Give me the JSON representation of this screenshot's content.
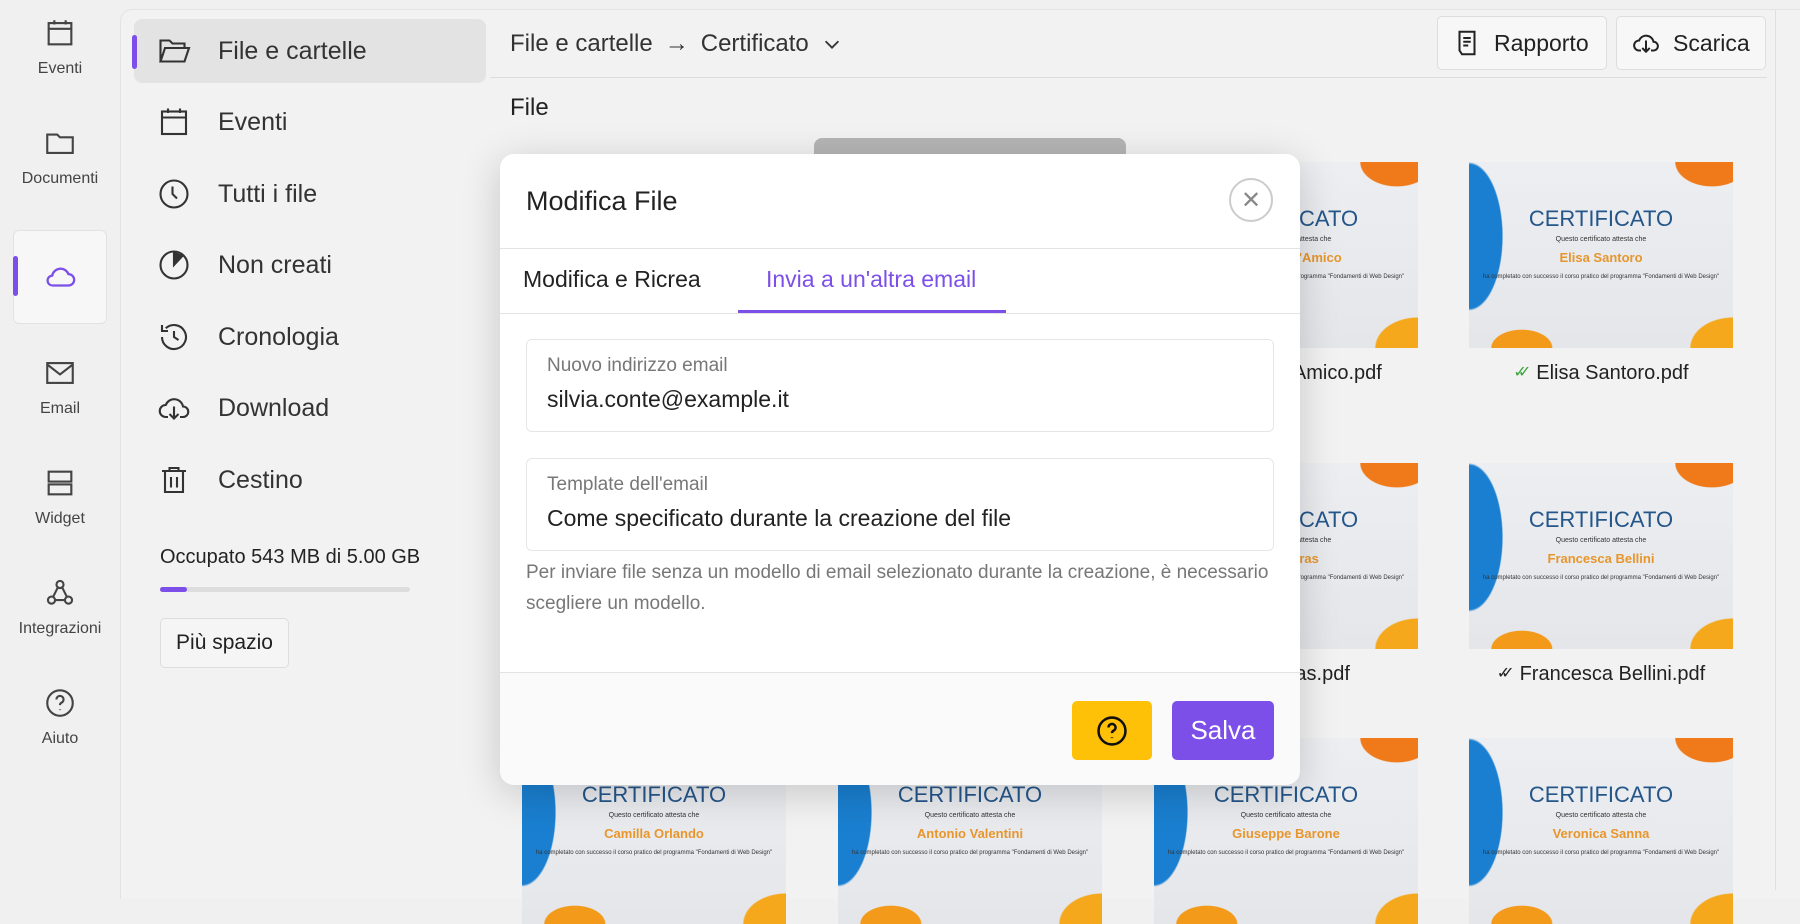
{
  "rail": {
    "items": [
      {
        "label": "Eventi",
        "icon": "calendar-icon"
      },
      {
        "label": "Documenti",
        "icon": "folder-icon"
      },
      {
        "label": "",
        "icon": "cloud-icon",
        "active": true
      },
      {
        "label": "Email",
        "icon": "mail-icon"
      },
      {
        "label": "Widget",
        "icon": "widget-icon"
      },
      {
        "label": "Integrazioni",
        "icon": "webhook-icon"
      },
      {
        "label": "Aiuto",
        "icon": "help-icon"
      }
    ]
  },
  "sidebar": {
    "items": [
      {
        "label": "File e cartelle",
        "icon": "folder-open-icon",
        "active": true
      },
      {
        "label": "Eventi",
        "icon": "calendar-icon"
      },
      {
        "label": "Tutti i file",
        "icon": "clock-icon"
      },
      {
        "label": "Non creati",
        "icon": "pie-icon"
      },
      {
        "label": "Cronologia",
        "icon": "history-icon"
      },
      {
        "label": "Download",
        "icon": "cloud-download-icon"
      },
      {
        "label": "Cestino",
        "icon": "trash-icon"
      }
    ],
    "storage_text": "Occupato 543 MB di 5.00 GB",
    "storage_used_fraction": 0.106,
    "more_space": "Più spazio"
  },
  "header": {
    "crumb_root": "File e cartelle",
    "crumb_sep": "→",
    "crumb_current": "Certificato",
    "report": "Rapporto",
    "download": "Scarica"
  },
  "section_title": "File",
  "certificate": {
    "title": "CERTIFICATO",
    "intro": "Questo certificato attesta che",
    "body": "ha completato con successo il corso pratico del programma \"Fondamenti di Web Design\""
  },
  "files": [
    {
      "person": "",
      "label": ""
    },
    {
      "person": "",
      "label": ""
    },
    {
      "person": "Riccardo D'Amico",
      "label": "Riccardo D'Amico.pdf"
    },
    {
      "person": "Elisa Santoro",
      "label": "Elisa Santoro.pdf",
      "status": "sent",
      "status_color": "#3aa53a"
    },
    {
      "person": "",
      "label": ""
    },
    {
      "person": "",
      "label": ""
    },
    {
      "person": "Luca Piras",
      "label": "Luca Piras.pdf"
    },
    {
      "person": "Francesca Bellini",
      "label": "Francesca Bellini.pdf",
      "status": "delivered",
      "status_color": "#222222"
    },
    {
      "person": "Camilla Orlando",
      "label": ""
    },
    {
      "person": "Antonio Valentini",
      "label": ""
    },
    {
      "person": "Giuseppe Barone",
      "label": ""
    },
    {
      "person": "Veronica Sanna",
      "label": ""
    }
  ],
  "modal": {
    "title": "Modifica File",
    "tabs": [
      "Modifica e Ricrea",
      "Invia a un'altra email"
    ],
    "active_tab": 1,
    "email_label": "Nuovo indirizzo email",
    "email_value": "silvia.conte@example.it",
    "template_label": "Template dell'email",
    "template_value": "Come specificato durante la creazione del file",
    "help_text": "Per inviare file senza un modello di email selezionato durante la creazione, è necessario scegliere un modello.",
    "save": "Salva"
  },
  "colors": {
    "accent": "#7b4fe8",
    "help_button": "#ffc107"
  }
}
